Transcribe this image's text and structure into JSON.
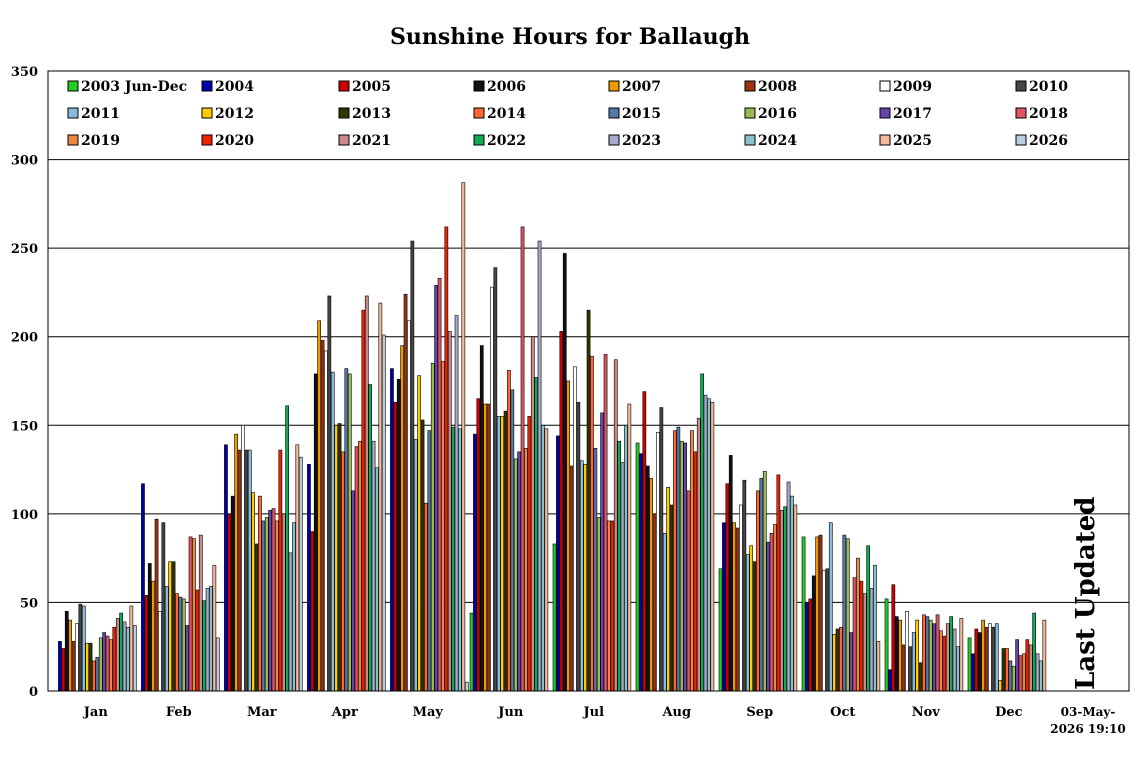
{
  "chart_data": {
    "type": "bar",
    "title": "Sunshine Hours for Ballaugh",
    "xlabel": "",
    "ylabel": "",
    "ylim": [
      0,
      350
    ],
    "yticks": [
      0,
      50,
      100,
      150,
      200,
      250,
      300,
      350
    ],
    "grid": true,
    "legend_position": "top",
    "categories": [
      "Jan",
      "Feb",
      "Mar",
      "Apr",
      "May",
      "Jun",
      "Jul",
      "Aug",
      "Sep",
      "Oct",
      "Nov",
      "Dec"
    ],
    "series": [
      {
        "name": "2003 Jun-Dec",
        "color": "#22cc22",
        "values": [
          null,
          null,
          null,
          null,
          null,
          44,
          83,
          140,
          69,
          87,
          52,
          30
        ]
      },
      {
        "name": "2004",
        "color": "#0000aa",
        "values": [
          28,
          117,
          139,
          128,
          182,
          145,
          144,
          134,
          95,
          50,
          12,
          21
        ]
      },
      {
        "name": "2005",
        "color": "#cc0000",
        "values": [
          24,
          54,
          100,
          90,
          163,
          165,
          203,
          169,
          117,
          52,
          60,
          35
        ]
      },
      {
        "name": "2006",
        "color": "#111111",
        "values": [
          45,
          72,
          110,
          179,
          176,
          195,
          247,
          127,
          133,
          65,
          42,
          33
        ]
      },
      {
        "name": "2007",
        "color": "#ee9900",
        "values": [
          40,
          62,
          145,
          209,
          195,
          162,
          175,
          120,
          95,
          87,
          40,
          40
        ]
      },
      {
        "name": "2008",
        "color": "#993311",
        "values": [
          28,
          97,
          136,
          198,
          224,
          162,
          127,
          100,
          92,
          88,
          26,
          36
        ]
      },
      {
        "name": "2009",
        "color": "#ffffff",
        "values": [
          38,
          45,
          150,
          192,
          209,
          228,
          183,
          146,
          105,
          68,
          45,
          38
        ]
      },
      {
        "name": "2010",
        "color": "#444444",
        "values": [
          49,
          95,
          136,
          223,
          254,
          239,
          163,
          160,
          119,
          69,
          25,
          36
        ]
      },
      {
        "name": "2011",
        "color": "#88bbdd",
        "values": [
          48,
          59,
          136,
          180,
          142,
          155,
          130,
          89,
          77,
          95,
          33,
          38
        ]
      },
      {
        "name": "2012",
        "color": "#ffcc00",
        "values": [
          27,
          73,
          112,
          150,
          178,
          155,
          128,
          115,
          82,
          32,
          40,
          6
        ]
      },
      {
        "name": "2013",
        "color": "#333300",
        "values": [
          27,
          73,
          83,
          151,
          153,
          158,
          215,
          105,
          73,
          35,
          16,
          24
        ]
      },
      {
        "name": "2014",
        "color": "#ff6633",
        "values": [
          17,
          55,
          110,
          135,
          106,
          181,
          189,
          147,
          113,
          36,
          43,
          24
        ]
      },
      {
        "name": "2015",
        "color": "#5577aa",
        "values": [
          19,
          53,
          96,
          182,
          147,
          170,
          137,
          149,
          120,
          88,
          42,
          17
        ]
      },
      {
        "name": "2016",
        "color": "#99bb55",
        "values": [
          30,
          52,
          98,
          179,
          185,
          131,
          98,
          141,
          124,
          86,
          40,
          14
        ]
      },
      {
        "name": "2017",
        "color": "#6644aa",
        "values": [
          33,
          37,
          102,
          113,
          229,
          135,
          157,
          140,
          84,
          33,
          38,
          29
        ]
      },
      {
        "name": "2018",
        "color": "#dd5566",
        "values": [
          31,
          87,
          103,
          138,
          233,
          262,
          190,
          113,
          89,
          64,
          43,
          20
        ]
      },
      {
        "name": "2019",
        "color": "#ee8844",
        "values": [
          29,
          86,
          96,
          141,
          186,
          137,
          96,
          147,
          94,
          75,
          34,
          21
        ]
      },
      {
        "name": "2020",
        "color": "#ee2200",
        "values": [
          36,
          57,
          136,
          215,
          262,
          155,
          96,
          135,
          122,
          62,
          31,
          29
        ]
      },
      {
        "name": "2021",
        "color": "#cc8888",
        "values": [
          41,
          88,
          100,
          223,
          203,
          200,
          187,
          154,
          102,
          55,
          38,
          26
        ]
      },
      {
        "name": "2022",
        "color": "#11aa55",
        "values": [
          44,
          51,
          161,
          173,
          149,
          177,
          141,
          179,
          104,
          82,
          42,
          44
        ]
      },
      {
        "name": "2023",
        "color": "#aaaacc",
        "values": [
          39,
          58,
          78,
          141,
          212,
          254,
          129,
          167,
          118,
          58,
          35,
          21
        ]
      },
      {
        "name": "2024",
        "color": "#88c0cc",
        "values": [
          36,
          59,
          95,
          126,
          148,
          150,
          150,
          165,
          110,
          71,
          25,
          17
        ]
      },
      {
        "name": "2025",
        "color": "#f4b89a",
        "values": [
          48,
          71,
          139,
          219,
          287,
          148,
          162,
          163,
          105,
          28,
          41,
          40
        ]
      },
      {
        "name": "2026",
        "color": "#bbccdd",
        "values": [
          37,
          30,
          132,
          201,
          5,
          null,
          null,
          null,
          null,
          null,
          null,
          null
        ]
      }
    ]
  },
  "side_label": "Last Updated",
  "updated_date": "03-May-",
  "updated_time": "2026 19:10"
}
